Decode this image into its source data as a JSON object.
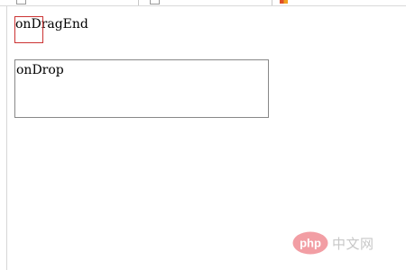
{
  "drag_source": {
    "label": "onDragEnd",
    "border_color": "#cc3333"
  },
  "drop_target": {
    "label": "onDrop",
    "border_color": "#888888"
  },
  "watermark": {
    "logo_text": "php",
    "site_text": "中文网",
    "logo_color": "#e8505b"
  },
  "tabs": [
    {
      "icon": "page-icon"
    },
    {
      "icon": "page-icon"
    },
    {
      "icon": "favicon-icon"
    }
  ]
}
